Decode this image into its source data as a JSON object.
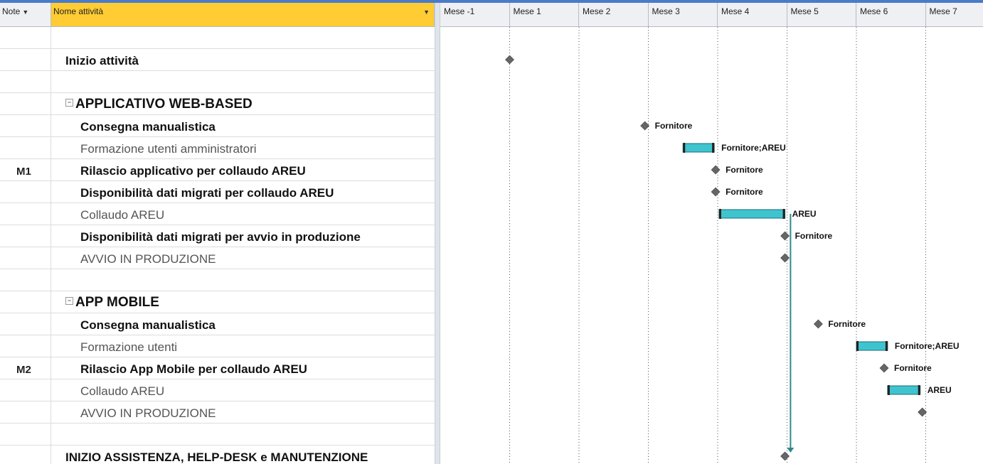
{
  "header": {
    "note_label": "Note",
    "name_label": "Nome attività"
  },
  "tasks": [
    {
      "note": "",
      "name": "",
      "style": "none"
    },
    {
      "note": "",
      "name": "Inizio attività",
      "style": "bold-l1"
    },
    {
      "note": "",
      "name": "",
      "style": "none"
    },
    {
      "note": "",
      "name": "APPLICATIVO WEB-BASED",
      "style": "summary"
    },
    {
      "note": "",
      "name": "Consegna manualistica",
      "style": "bold-l2"
    },
    {
      "note": "",
      "name": "Formazione utenti amministratori",
      "style": "light-l2"
    },
    {
      "note": "M1",
      "name": "Rilascio applicativo per collaudo AREU",
      "style": "bold-l2"
    },
    {
      "note": "",
      "name": "Disponibilità dati migrati per collaudo AREU",
      "style": "bold-l2"
    },
    {
      "note": "",
      "name": "Collaudo AREU",
      "style": "light-l2"
    },
    {
      "note": "",
      "name": "Disponibilità dati migrati per avvio in produzione",
      "style": "bold-l2"
    },
    {
      "note": "",
      "name": "AVVIO IN PRODUZIONE",
      "style": "light-l2"
    },
    {
      "note": "",
      "name": "",
      "style": "none"
    },
    {
      "note": "",
      "name": "APP MOBILE",
      "style": "summary"
    },
    {
      "note": "",
      "name": "Consegna manualistica",
      "style": "bold-l2"
    },
    {
      "note": "",
      "name": "Formazione utenti",
      "style": "light-l2"
    },
    {
      "note": "M2",
      "name": "Rilascio App Mobile per collaudo AREU",
      "style": "bold-l2"
    },
    {
      "note": "",
      "name": "Collaudo AREU",
      "style": "light-l2"
    },
    {
      "note": "",
      "name": "AVVIO IN PRODUZIONE",
      "style": "light-l2"
    },
    {
      "note": "",
      "name": "",
      "style": "none"
    },
    {
      "note": "",
      "name": "INIZIO ASSISTENZA, HELP-DESK e MANUTENZIONE",
      "style": "bold-l1"
    }
  ],
  "timescale": {
    "months": [
      "Mese -1",
      "Mese 1",
      "Mese 2",
      "Mese 3",
      "Mese 4",
      "Mese 5",
      "Mese 6",
      "Mese 7"
    ]
  },
  "gantt_items": [
    {
      "row": 1,
      "type": "milestone",
      "at": 1.0,
      "label": ""
    },
    {
      "row": 4,
      "type": "milestone",
      "at": 2.95,
      "label": "Fornitore"
    },
    {
      "row": 5,
      "type": "bar",
      "start": 3.5,
      "end": 3.95,
      "label": "Fornitore;AREU"
    },
    {
      "row": 6,
      "type": "milestone",
      "at": 3.97,
      "label": "Fornitore"
    },
    {
      "row": 7,
      "type": "milestone",
      "at": 3.97,
      "label": "Fornitore"
    },
    {
      "row": 8,
      "type": "bar",
      "start": 4.02,
      "end": 4.97,
      "label": "AREU"
    },
    {
      "row": 9,
      "type": "milestone",
      "at": 4.97,
      "label": "Fornitore"
    },
    {
      "row": 10,
      "type": "milestone",
      "at": 4.97,
      "label": ""
    },
    {
      "row": 13,
      "type": "milestone",
      "at": 5.45,
      "label": "Fornitore"
    },
    {
      "row": 14,
      "type": "bar",
      "start": 6.0,
      "end": 6.45,
      "label": "Fornitore;AREU"
    },
    {
      "row": 15,
      "type": "milestone",
      "at": 6.4,
      "label": "Fornitore"
    },
    {
      "row": 16,
      "type": "bar",
      "start": 6.45,
      "end": 6.92,
      "label": "AREU"
    },
    {
      "row": 17,
      "type": "milestone",
      "at": 6.95,
      "label": ""
    },
    {
      "row": 19,
      "type": "milestone",
      "at": 4.97,
      "label": ""
    }
  ],
  "links": [
    {
      "from_row": 8,
      "to_row": 19,
      "at": 5.05
    }
  ],
  "colors": {
    "bar_fill": "#3fc4cf",
    "bar_dark": "#1b6c75",
    "milestone": "#666666",
    "link": "#2b8a8f",
    "header_highlight": "#ffcc33"
  }
}
